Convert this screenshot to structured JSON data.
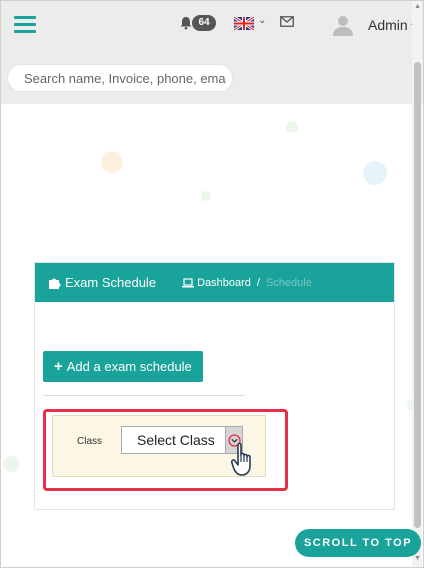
{
  "header": {
    "notification_count": "64",
    "user_name": "Admin"
  },
  "search": {
    "placeholder": "Search name, Invoice, phone, ema"
  },
  "card": {
    "title": "Exam Schedule",
    "breadcrumb": {
      "home": "Dashboard",
      "separator": "/",
      "current": "Schedule"
    },
    "add_button_label": "Add a exam schedule",
    "filter": {
      "label": "Class",
      "select_value": "Select Class"
    }
  },
  "scroll_top_label": "SCROLL TO TOP",
  "colors": {
    "accent": "#1aa39a",
    "highlight": "#e53048",
    "filter_bg": "#fcf6e5"
  },
  "icons": [
    "menu-icon",
    "bell-icon",
    "uk-flag-icon",
    "mail-icon",
    "avatar-icon",
    "puzzle-icon",
    "laptop-icon",
    "plus-icon",
    "chevron-down-icon",
    "hand-pointer-icon"
  ]
}
